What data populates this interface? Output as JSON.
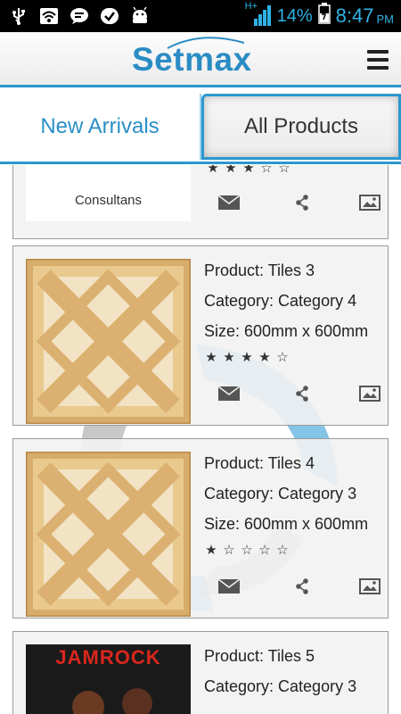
{
  "status_bar": {
    "signal_label": "H+",
    "battery_percent": "14%",
    "time": "8:47",
    "ampm": "PM",
    "icons": [
      "usb-icon",
      "wifi-icon",
      "chat-icon",
      "check-icon",
      "android-icon",
      "signal-icon",
      "battery-icon"
    ]
  },
  "header": {
    "logo_text": "Setmax",
    "menu_icon": "hamburger-menu-icon"
  },
  "tabs": [
    {
      "label": "New Arrivals",
      "selected": true
    },
    {
      "label": "All Products",
      "selected": false
    }
  ],
  "accent_color": "#2d97cf",
  "products": [
    {
      "image_caption": "Consultans",
      "rating": 3,
      "rating_max": 5
    },
    {
      "product_line": "Product: Tiles 3",
      "category_line": "Category: Category 4",
      "size_line": "Size: 600mm x 600mm",
      "rating": 4,
      "rating_max": 5
    },
    {
      "product_line": "Product: Tiles 4",
      "category_line": "Category: Category 3",
      "size_line": "Size: 600mm x 600mm",
      "rating": 1,
      "rating_max": 5
    },
    {
      "image_text": "JAMROCK",
      "product_line": "Product: Tiles 5",
      "category_line": "Category: Category 3"
    }
  ],
  "action_icons": [
    "mail-icon",
    "share-icon",
    "image-icon"
  ]
}
